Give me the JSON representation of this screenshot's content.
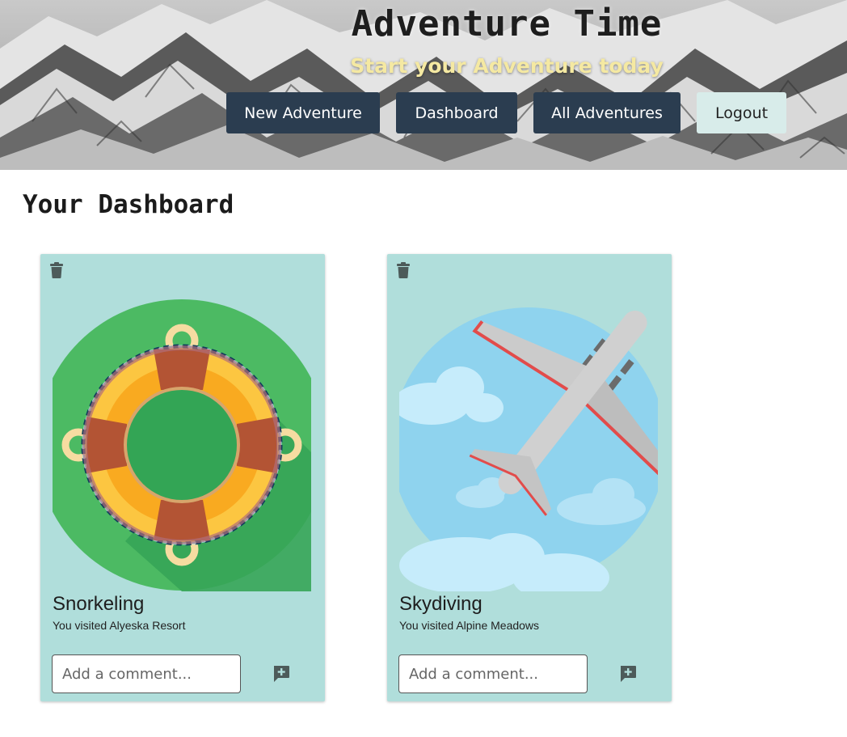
{
  "header": {
    "title": "Adventure Time",
    "subtitle": "Start your Adventure today",
    "nav": [
      {
        "label": "New Adventure"
      },
      {
        "label": "Dashboard"
      },
      {
        "label": "All Adventures"
      },
      {
        "label": "Logout"
      }
    ]
  },
  "page_title": "Your Dashboard",
  "cards": [
    {
      "title": "Snorkeling",
      "subtitle": "You visited Alyeska Resort",
      "image_icon": "life-ring-icon",
      "comment_placeholder": "Add a comment..."
    },
    {
      "title": "Skydiving",
      "subtitle": "You visited Alpine Meadows",
      "image_icon": "airplane-icon",
      "comment_placeholder": "Add a comment..."
    }
  ],
  "colors": {
    "nav_dark": "#2b3d50",
    "nav_light": "#d8ecea",
    "card_bg": "#b0dedb",
    "subtitle": "#f5e9a2",
    "icon": "#4d5b5a"
  }
}
